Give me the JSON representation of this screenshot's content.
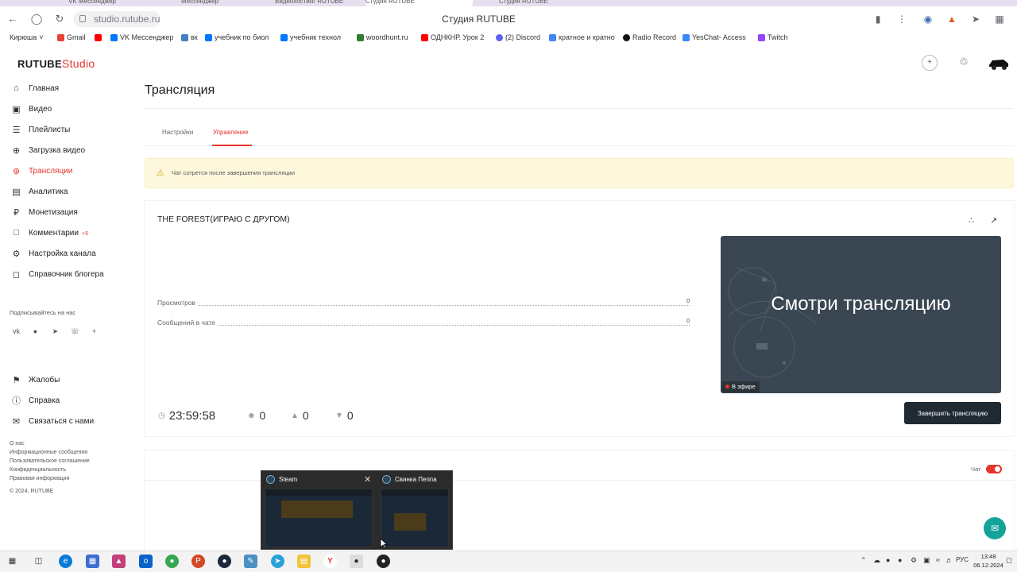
{
  "browser": {
    "tabs": [
      "VK Мессенджер",
      "Мессенджер",
      "Видеохостинг RUTUBE",
      "Студия RUTUBE",
      "Студия RUTUBE"
    ],
    "url": "studio.rutube.ru",
    "page_title": "Студия RUTUBE",
    "bookmarks": [
      {
        "label": "Кирюша",
        "icon": "folder-icon",
        "color": "#555555"
      },
      {
        "label": "Gmail",
        "icon": "gmail-icon",
        "color": "#ea4335"
      },
      {
        "label": "",
        "icon": "youtube-icon",
        "color": "#ff0000"
      },
      {
        "label": "VK Мессенджер",
        "icon": "vk-icon",
        "color": "#0077ff"
      },
      {
        "label": "вк",
        "icon": "vk-icon",
        "color": "#4680c2"
      },
      {
        "label": "учебник по биол",
        "icon": "vk-icon",
        "color": "#0077ff"
      },
      {
        "label": "учебник технол",
        "icon": "vk-icon",
        "color": "#0077ff"
      },
      {
        "label": "woordhunt.ru",
        "icon": "site-icon",
        "color": "#2e7d32"
      },
      {
        "label": "ОДНКНР. Урок 2",
        "icon": "youtube-icon",
        "color": "#ff0000"
      },
      {
        "label": "(2) Discord",
        "icon": "discord-icon",
        "color": "#5865f2"
      },
      {
        "label": "кратное и кратно",
        "icon": "page-icon",
        "color": "#4285f4"
      },
      {
        "label": "Radio Record",
        "icon": "radio-icon",
        "color": "#111111"
      },
      {
        "label": "YesChat- Access",
        "icon": "site-icon",
        "color": "#3a86ff"
      },
      {
        "label": "Twitch",
        "icon": "twitch-icon",
        "color": "#9146ff"
      }
    ]
  },
  "studio": {
    "logo_main": "RUTUBE",
    "logo_sub": "Studio",
    "accent_color": "#e4342c",
    "nav": [
      {
        "label": "Главная",
        "icon": "home-icon"
      },
      {
        "label": "Видео",
        "icon": "video-icon"
      },
      {
        "label": "Плейлисты",
        "icon": "playlist-icon"
      },
      {
        "label": "Загрузка видео",
        "icon": "upload-icon"
      },
      {
        "label": "Трансляции",
        "icon": "broadcast-icon",
        "active": true
      },
      {
        "label": "Аналитика",
        "icon": "analytics-icon"
      },
      {
        "label": "Монетизация",
        "icon": "money-icon"
      },
      {
        "label": "Комментарии",
        "icon": "comments-icon",
        "badge": "+5"
      },
      {
        "label": "Настройка канала",
        "icon": "settings-icon"
      },
      {
        "label": "Справочник блогера",
        "icon": "guide-icon"
      }
    ],
    "subscribe_label": "Подписывайтесь на нас",
    "social": [
      "vk-icon",
      "ok-icon",
      "telegram-icon",
      "viber-icon",
      "plus-icon"
    ],
    "bottom_nav": [
      {
        "label": "Жалобы",
        "icon": "flag-icon"
      },
      {
        "label": "Справка",
        "icon": "help-icon"
      },
      {
        "label": "Связаться с нами",
        "icon": "mail-icon"
      }
    ],
    "footer_links": [
      "О нас",
      "Информационные сообщения",
      "Пользовательское соглашение",
      "Конфиденциальность",
      "Правовая информация",
      "© 2024, RUTUBE"
    ]
  },
  "main": {
    "title": "Трансляция",
    "tabs": [
      {
        "label": "Настройки",
        "active": false
      },
      {
        "label": "Управление",
        "active": true
      }
    ],
    "notice": "Чат сотрется после завершения трансляции",
    "stream": {
      "title": "THE FOREST(ИГРАЮ С ДРУГОМ)",
      "stats": [
        {
          "label": "Просмотров",
          "value": "0"
        },
        {
          "label": "Сообщений в чате",
          "value": "0"
        }
      ],
      "preview_text": "Смотри трансляцию",
      "live_label": "В эфире",
      "timer": "23:59:58",
      "viewers": "0",
      "likes": "0",
      "dislikes": "0",
      "end_button": "Завершить трансляцию"
    },
    "chat": {
      "label": "Чат",
      "enabled": true
    }
  },
  "taskbar_popup": {
    "items": [
      {
        "title": "Steam",
        "icon": "steam-icon"
      },
      {
        "title": "Свинка Пеппа",
        "icon": "steam-icon"
      }
    ]
  },
  "taskbar": {
    "apps": [
      "start-icon",
      "search-icon",
      "task-view-icon",
      "edge-icon",
      "store-icon",
      "photos-icon",
      "outlook-icon",
      "chrome-icon",
      "powerpoint-icon",
      "steam-icon",
      "notepad-icon",
      "telegram-icon",
      "explorer-icon",
      "yandex-icon",
      "steam-icon",
      "obs-icon"
    ],
    "language": "РУС",
    "time": "13:48",
    "date": "06.12.2024"
  }
}
